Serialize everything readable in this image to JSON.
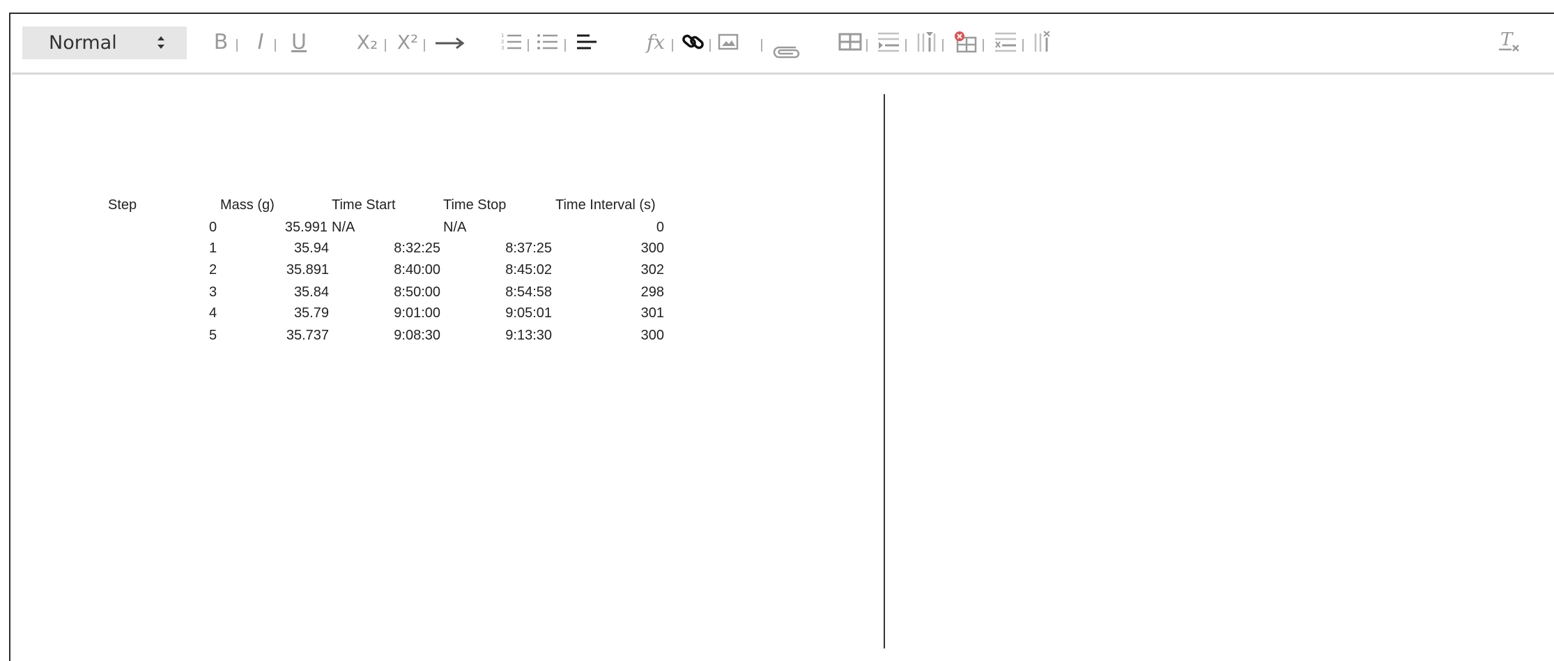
{
  "toolbar": {
    "style_select": "Normal",
    "icons": [
      "bold-icon",
      "italic-icon",
      "underline-icon",
      "subscript-icon",
      "superscript-icon",
      "arrow-right-icon",
      "ordered-list-icon",
      "bullet-list-icon",
      "align-left-icon",
      "formula-icon",
      "link-icon",
      "image-icon",
      "attachment-icon",
      "table-icon",
      "insert-row-above-icon",
      "insert-column-icon",
      "delete-table-icon",
      "delete-row-icon",
      "delete-column-icon",
      "clear-format-icon"
    ],
    "bold": "B",
    "italic": "I",
    "underline": "U",
    "subscript": "X₂",
    "superscript": "X²",
    "formula": "fx"
  },
  "table": {
    "headers": [
      "Step",
      "Mass (g)",
      "Time Start",
      "Time Stop",
      "Time Interval (s)"
    ],
    "rows": [
      {
        "step": "0",
        "mass": "35.991",
        "start": "N/A",
        "stop": "N/A",
        "interval": "0"
      },
      {
        "step": "1",
        "mass": "35.94",
        "start": "8:32:25",
        "stop": "8:37:25",
        "interval": "300"
      },
      {
        "step": "2",
        "mass": "35.891",
        "start": "8:40:00",
        "stop": "8:45:02",
        "interval": "302"
      },
      {
        "step": "3",
        "mass": "35.84",
        "start": "8:50:00",
        "stop": "8:54:58",
        "interval": "298"
      },
      {
        "step": "4",
        "mass": "35.79",
        "start": "9:01:00",
        "stop": "9:05:01",
        "interval": "301"
      },
      {
        "step": "5",
        "mass": "35.737",
        "start": "9:08:30",
        "stop": "9:13:30",
        "interval": "300"
      }
    ]
  },
  "colors": {
    "toolbar_select_bg": "#e6e6e6",
    "icon_gray": "#9a9a9a",
    "icon_dark": "#1a1a1a",
    "delete_red": "#e05050"
  }
}
